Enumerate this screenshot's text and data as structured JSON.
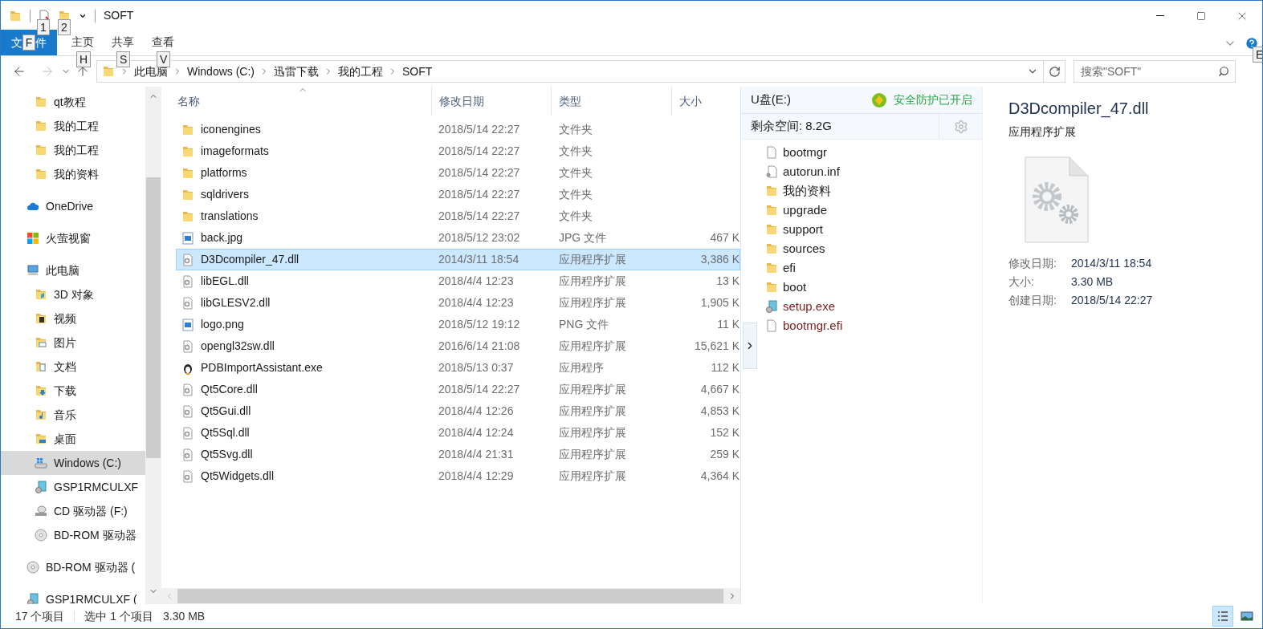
{
  "window": {
    "title": "SOFT"
  },
  "keytips": {
    "quick_access": [
      "1",
      "2"
    ],
    "help": "E"
  },
  "ribbon_tabs": [
    {
      "label_parts": [
        "文",
        "件"
      ],
      "kind": "file",
      "keytip": "F"
    },
    {
      "label": "主页",
      "kind": "tab",
      "keytip": "H"
    },
    {
      "label": "共享",
      "kind": "tab",
      "keytip": "S"
    },
    {
      "label": "查看",
      "kind": "tab",
      "keytip": "V"
    }
  ],
  "breadcrumbs": [
    "此电脑",
    "Windows (C:)",
    "迅雷下载",
    "我的工程",
    "SOFT"
  ],
  "search": {
    "placeholder": "搜索\"SOFT\""
  },
  "quick_access_items": [
    {
      "label": "qt教程",
      "kind": "folder",
      "selected": false
    },
    {
      "label": "我的工程",
      "kind": "folder",
      "selected": false
    },
    {
      "label": "我的工程",
      "kind": "folder",
      "selected": false
    },
    {
      "label": "我的资料",
      "kind": "folder",
      "selected": false
    }
  ],
  "nav_items": [
    {
      "label": "OneDrive",
      "kind": "cloud",
      "selected": false
    },
    {
      "label": "火萤视窗",
      "kind": "app",
      "selected": false
    },
    {
      "label": "此电脑",
      "kind": "pc",
      "selected": false,
      "children": [
        {
          "label": "3D 对象",
          "kind": "folder3d",
          "selected": false
        },
        {
          "label": "视频",
          "kind": "foldervideo",
          "selected": false
        },
        {
          "label": "图片",
          "kind": "folderpicture",
          "selected": false
        },
        {
          "label": "文档",
          "kind": "folderdoc",
          "selected": false
        },
        {
          "label": "下载",
          "kind": "folderdownload",
          "selected": false
        },
        {
          "label": "音乐",
          "kind": "foldermusic",
          "selected": false
        },
        {
          "label": "桌面",
          "kind": "folderdesktop",
          "selected": false
        },
        {
          "label": "Windows (C:)",
          "kind": "drive",
          "selected": true
        },
        {
          "label": "GSP1RMCULXF",
          "kind": "setup",
          "selected": false
        },
        {
          "label": "CD 驱动器 (F:)",
          "kind": "cd",
          "selected": false
        },
        {
          "label": "BD-ROM 驱动器",
          "kind": "disc",
          "selected": false
        }
      ]
    },
    {
      "label": "BD-ROM 驱动器 (",
      "kind": "disc",
      "selected": false
    },
    {
      "label": "GSP1RMCULXF (",
      "kind": "setup",
      "selected": false
    }
  ],
  "table": {
    "columns": [
      "名称",
      "修改日期",
      "类型",
      "大小"
    ],
    "rows": [
      {
        "name": "iconengines",
        "kind": "folder",
        "date": "2018/5/14 22:27",
        "type": "文件夹",
        "selected": false
      },
      {
        "name": "imageformats",
        "kind": "folder",
        "date": "2018/5/14 22:27",
        "type": "文件夹",
        "selected": false
      },
      {
        "name": "platforms",
        "kind": "folder",
        "date": "2018/5/14 22:27",
        "type": "文件夹",
        "selected": false
      },
      {
        "name": "sqldrivers",
        "kind": "folder",
        "date": "2018/5/14 22:27",
        "type": "文件夹",
        "selected": false
      },
      {
        "name": "translations",
        "kind": "folder",
        "date": "2018/5/14 22:27",
        "type": "文件夹",
        "selected": false
      },
      {
        "name": "back.jpg",
        "kind": "image",
        "date": "2018/5/12 23:02",
        "type": "JPG 文件",
        "size": "467 K",
        "selected": false
      },
      {
        "name": "D3Dcompiler_47.dll",
        "kind": "dll",
        "date": "2014/3/11 18:54",
        "type": "应用程序扩展",
        "size": "3,386 K",
        "selected": true
      },
      {
        "name": "libEGL.dll",
        "kind": "dll",
        "date": "2018/4/4 12:23",
        "type": "应用程序扩展",
        "size": "13 K",
        "selected": false
      },
      {
        "name": "libGLESV2.dll",
        "kind": "dll",
        "date": "2018/4/4 12:23",
        "type": "应用程序扩展",
        "size": "1,905 K",
        "selected": false
      },
      {
        "name": "logo.png",
        "kind": "image",
        "date": "2018/5/12 19:12",
        "type": "PNG 文件",
        "size": "11 K",
        "selected": false
      },
      {
        "name": "opengl32sw.dll",
        "kind": "dll",
        "date": "2016/6/14 21:08",
        "type": "应用程序扩展",
        "size": "15,621 K",
        "selected": false
      },
      {
        "name": "PDBImportAssistant.exe",
        "kind": "exe",
        "date": "2018/5/13 0:37",
        "type": "应用程序",
        "size": "112 K",
        "selected": false
      },
      {
        "name": "Qt5Core.dll",
        "kind": "dll",
        "date": "2018/5/14 22:27",
        "type": "应用程序扩展",
        "size": "4,667 K",
        "selected": false
      },
      {
        "name": "Qt5Gui.dll",
        "kind": "dll",
        "date": "2018/4/4 12:26",
        "type": "应用程序扩展",
        "size": "4,853 K",
        "selected": false
      },
      {
        "name": "Qt5Sql.dll",
        "kind": "dll",
        "date": "2018/4/4 12:24",
        "type": "应用程序扩展",
        "size": "152 K",
        "selected": false
      },
      {
        "name": "Qt5Svg.dll",
        "kind": "dll",
        "date": "2018/4/4 21:31",
        "type": "应用程序扩展",
        "size": "259 K",
        "selected": false
      },
      {
        "name": "Qt5Widgets.dll",
        "kind": "dll",
        "date": "2018/4/4 12:29",
        "type": "应用程序扩展",
        "size": "4,364 K",
        "selected": false
      }
    ]
  },
  "usb_panel": {
    "title": "U盘(E:)",
    "protection": "安全防护已开启",
    "free_space": "剩余空间: 8.2G",
    "items": [
      {
        "name": "bootmgr",
        "kind": "file",
        "color": "#222222"
      },
      {
        "name": "autorun.inf",
        "kind": "ini",
        "color": "#222222"
      },
      {
        "name": "我的资料",
        "kind": "folder",
        "color": "#222222"
      },
      {
        "name": "upgrade",
        "kind": "folder",
        "color": "#222222"
      },
      {
        "name": "support",
        "kind": "folder",
        "color": "#222222"
      },
      {
        "name": "sources",
        "kind": "folder",
        "color": "#222222"
      },
      {
        "name": "efi",
        "kind": "folder",
        "color": "#222222"
      },
      {
        "name": "boot",
        "kind": "folder",
        "color": "#222222"
      },
      {
        "name": "setup.exe",
        "kind": "setup",
        "color": "#7b1c1c"
      },
      {
        "name": "bootmgr.efi",
        "kind": "file",
        "color": "#7b1c1c"
      }
    ]
  },
  "details": {
    "title": "D3Dcompiler_47.dll",
    "type": "应用程序扩展",
    "properties": [
      {
        "label": "修改日期:",
        "value": "2014/3/11 18:54"
      },
      {
        "label": "大小:",
        "value": "3.30 MB"
      },
      {
        "label": "创建日期:",
        "value": "2018/5/14 22:27"
      }
    ]
  },
  "status_bar": {
    "count": "17 个项目",
    "selection": "选中 1 个项目",
    "size": "3.30 MB",
    "views": [
      {
        "kind": "details",
        "selected": true
      },
      {
        "kind": "large",
        "selected": false
      }
    ]
  }
}
